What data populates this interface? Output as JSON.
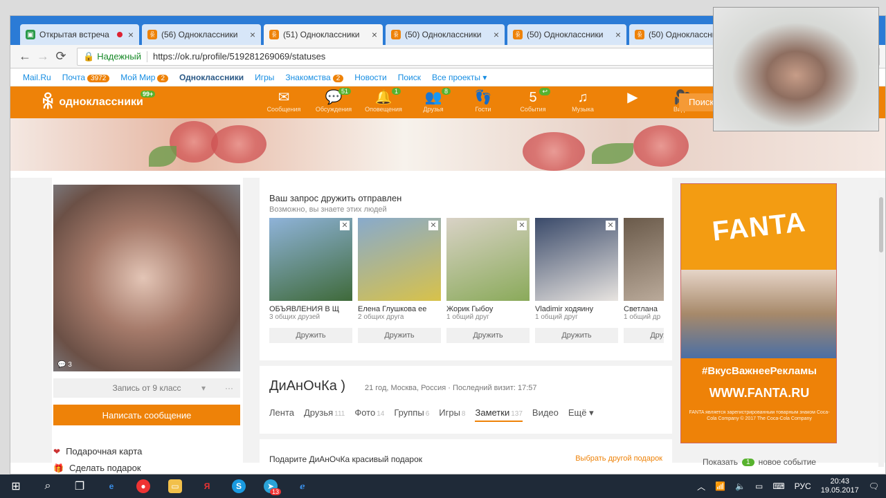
{
  "browser": {
    "tabs": [
      {
        "label": "Открытая встреча",
        "icon": "meet",
        "active": false,
        "recording": true
      },
      {
        "label": "(56) Одноклассники",
        "icon": "ok",
        "active": false
      },
      {
        "label": "(51) Одноклассники",
        "icon": "ok",
        "active": true
      },
      {
        "label": "(50) Одноклассники",
        "icon": "ok",
        "active": false
      },
      {
        "label": "(50) Одноклассники",
        "icon": "ok",
        "active": false
      },
      {
        "label": "(50) Одноклассники",
        "icon": "ok",
        "active": false
      }
    ],
    "secure_label": "Надежный",
    "url": "https://ok.ru/profile/519281269069/statuses"
  },
  "portal": {
    "items": [
      {
        "label": "Mail.Ru"
      },
      {
        "label": "Почта",
        "badge": "3972"
      },
      {
        "label": "Мой Мир",
        "badge": "2"
      },
      {
        "label": "Одноклассники",
        "bold": true
      },
      {
        "label": "Игры"
      },
      {
        "label": "Знакомства",
        "badge": "2"
      },
      {
        "label": "Новости"
      },
      {
        "label": "Поиск"
      },
      {
        "label": "Все проекты ▾"
      }
    ]
  },
  "ok_header": {
    "logo_text": "одноклассники",
    "logo_badge": "99+",
    "icons": [
      {
        "symbol": "✉",
        "label": "Сообщения",
        "name": "messages-icon"
      },
      {
        "symbol": "💬",
        "label": "Обсуждения",
        "count": "51",
        "name": "discussions-icon"
      },
      {
        "symbol": "🔔",
        "label": "Оповещения",
        "count": "1",
        "name": "notifications-icon"
      },
      {
        "symbol": "👥",
        "label": "Друзья",
        "count": "8",
        "name": "friends-icon"
      },
      {
        "symbol": "👣",
        "label": "Гости",
        "name": "guests-icon"
      },
      {
        "symbol": "5",
        "label": "События",
        "count": "↩",
        "name": "events-icon"
      },
      {
        "symbol": "♫",
        "label": "Музыка",
        "name": "music-icon"
      },
      {
        "symbol": "▶",
        "label": "",
        "name": "video-play-icon"
      },
      {
        "symbol": "🎥",
        "label": "Видео",
        "name": "video-camera-icon"
      }
    ],
    "search_label": "Поиск"
  },
  "profile": {
    "photo_count": "3",
    "note_select": "Запись от 9 класс",
    "write_message": "Написать сообщение",
    "links": [
      {
        "label": "Подарочная карта",
        "icon": "gift-card-icon"
      },
      {
        "label": "Сделать подарок",
        "icon": "gift-icon"
      }
    ],
    "name": "ДиАнОчКа )",
    "info": "21 год, Москва, Россия · Последний визит: 17:57",
    "tabs": [
      {
        "label": "Лента",
        "n": ""
      },
      {
        "label": "Друзья",
        "n": "111"
      },
      {
        "label": "Фото",
        "n": "14"
      },
      {
        "label": "Группы",
        "n": "6"
      },
      {
        "label": "Игры",
        "n": "8"
      },
      {
        "label": "Заметки",
        "n": "137",
        "active": true
      },
      {
        "label": "Видео",
        "n": ""
      },
      {
        "label": "Ещё",
        "n": "",
        "more": true
      }
    ],
    "gift_title": "Подарите ДиАнОчКа красивый подарок",
    "gift_other": "Выбрать другой подарок"
  },
  "friend_request": {
    "title": "Ваш запрос дружить отправлен",
    "subtitle": "Возможно, вы знаете этих людей",
    "add_label": "Дружить",
    "people": [
      {
        "name": "ОБЪЯВЛЕНИЯ В Щ",
        "mutual": "3 общих друзей",
        "color_a": "#3f6a3a",
        "color_b": "#8fb3d9"
      },
      {
        "name": "Елена Глушкова ее",
        "mutual": "2 общих друга",
        "color_a": "#d8c24a",
        "color_b": "#88aacc"
      },
      {
        "name": "Жорик Гыбоу",
        "mutual": "1 общий друг",
        "color_a": "#8aaa5a",
        "color_b": "#d9d2c6"
      },
      {
        "name": "Vladimir ходяину",
        "mutual": "1 общий друг",
        "color_a": "#e8e4e0",
        "color_b": "#3a4a6a"
      },
      {
        "name": "Светлана",
        "mutual": "1 общий др",
        "color_a": "#c7b7a7",
        "color_b": "#6a5a4a"
      }
    ]
  },
  "ad": {
    "brand": "FANTA",
    "slogan": "#ВкусВажнееРекламы",
    "url": "WWW.FANTA.RU",
    "fine_print": "FANTA является зарегистрированным товарным знаком Coca-Cola Company © 2017 The Coca-Cola Company"
  },
  "feed": {
    "show_label": "Показать",
    "show_count": "1",
    "show_suffix": "новое событие"
  },
  "taskbar": {
    "lang": "РУС",
    "time": "20:43",
    "date": "19.05.2017",
    "badge13": "13"
  }
}
